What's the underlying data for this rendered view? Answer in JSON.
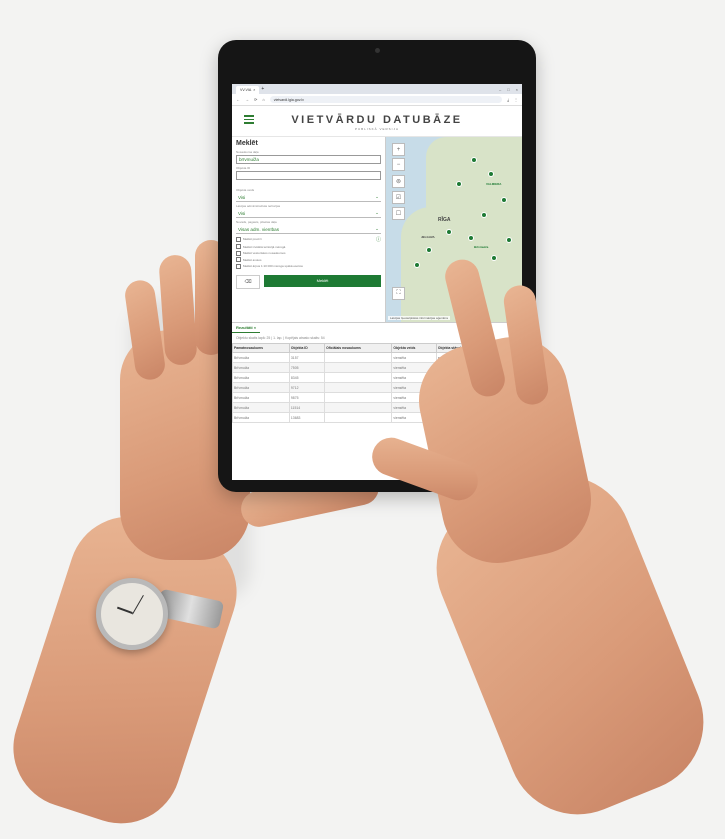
{
  "browser": {
    "tab_title": "VV.VIA",
    "url": "vietvardi.lgia.gov.lv"
  },
  "app": {
    "title": "VIETVĀRDU DATUBĀZE",
    "subtitle": "PUBLISKĀ VERSIJA"
  },
  "search": {
    "heading": "Meklēt",
    "name_label": "Nosaukuma daļa",
    "name_value": "brīvmuiža",
    "id_label": "Objekta ID",
    "id_value": "",
    "type_label": "Objekta veids",
    "type_value": "Visi",
    "admin_label": "Latvijas administratīvās teritorijas",
    "admin_value": "Visi",
    "county_label": "Novads, pagasts, pilsētas daļa",
    "county_value": "Visas adm. vienības",
    "checkboxes": [
      "Meklēt precīzi",
      "Meklēt izvēlētā teritorijā mērogā",
      "Meklēt vēsturiskos nosaukumos",
      "Meklēt avotos",
      "Meklēt ārpus 1:10 000 mēroga spēkā esošos"
    ],
    "search_button": "Meklēt"
  },
  "map": {
    "labels": [
      "VALMIERA",
      "RĪGA",
      "JELGAVA",
      "Brīvmuiža"
    ],
    "attribution": "Latvijas Ģeotelpiskās informācijas aģentūra"
  },
  "results": {
    "tab_label": "Rezultāti",
    "pagination": "Objektu skaits lapā:  25  |  1. lap.  |  Kopējais atrasto skaits: 54",
    "columns": [
      "Pamatnosaukums",
      "Objekta ID",
      "Oficiālais nosaukums",
      "Objekta veids",
      "Objekta stāvoklis",
      "Adrese"
    ],
    "rows": [
      [
        "Brīvmuiža",
        "3157",
        "",
        "viensēta",
        "esošs",
        "Ērgļu"
      ],
      [
        "Brīvmuiža",
        "7505",
        "",
        "viensēta",
        "pastāv",
        "Rūja"
      ],
      [
        "Brīvmuiža",
        "8345",
        "",
        "viensēta",
        "pastāv",
        "Dundag"
      ],
      [
        "Brīvmuiža",
        "9712",
        "",
        "viensēta",
        "pastāv",
        "Zīlāni"
      ],
      [
        "Brīvmuiža",
        "9875",
        "",
        "viensēta",
        "pastāv",
        "Rucava"
      ],
      [
        "Brīvmuiža",
        "11514",
        "",
        "viensēta",
        "pastāv",
        "Pļaviņ"
      ],
      [
        "Brīvmuiža",
        "13683",
        "",
        "viensēta",
        "pastāv",
        "Ozolnieki"
      ]
    ]
  },
  "colors": {
    "accent": "#1e7a34",
    "skin": "#dfa683",
    "background": "#f3f3f2"
  }
}
